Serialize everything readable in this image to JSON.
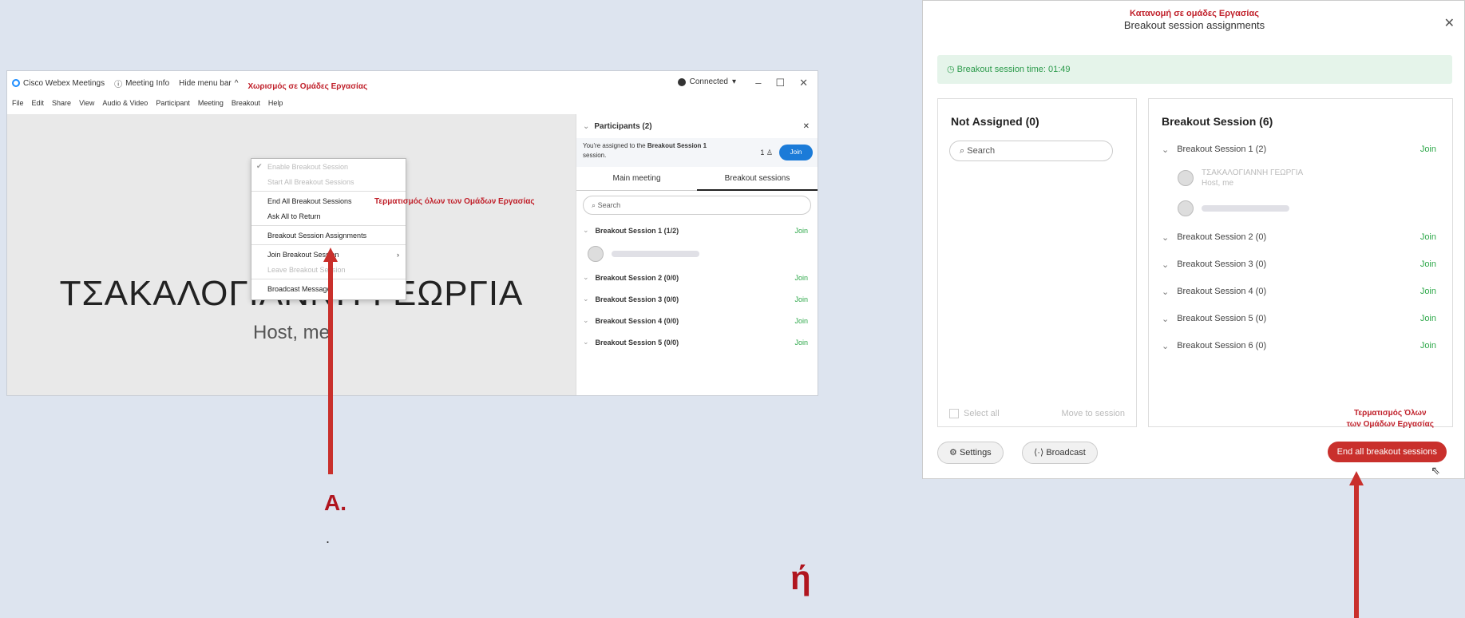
{
  "webex": {
    "app_name": "Cisco Webex Meetings",
    "meeting_info": "Meeting Info",
    "hide_menu": "Hide menu bar",
    "connected": "Connected",
    "menu": [
      "File",
      "Edit",
      "Share",
      "View",
      "Audio & Video",
      "Participant",
      "Meeting",
      "Breakout",
      "Help"
    ],
    "annotation_top": "Χωρισμός σε Ομάδες Εργασίας",
    "dropdown": [
      {
        "label": "Enable Breakout Session",
        "disabled": true
      },
      {
        "label": "Start All Breakout Sessions",
        "disabled": true
      },
      {
        "label": "End All Breakout Sessions",
        "disabled": false
      },
      {
        "label": "Ask All to Return",
        "disabled": false
      },
      {
        "label": "Breakout Session Assignments",
        "disabled": false
      },
      {
        "label": "Join Breakout Session",
        "disabled": false
      },
      {
        "label": "Leave Breakout Session",
        "disabled": true
      },
      {
        "label": "Broadcast Message",
        "disabled": false
      }
    ],
    "dropdown_annotation": "Τερματισμός όλων των Ομάδων Εργασίας",
    "stage_name": "ΤΣΑΚΑΛΟΓΙΑΝΝΗ ΓΕΩΡΓΙΑ",
    "stage_role": "Host, me",
    "participants": {
      "title": "Participants (2)",
      "assigned_msg_1": "You're assigned to the ",
      "assigned_msg_bold": "Breakout Session 1",
      "assigned_msg_2": " session.",
      "count": "1",
      "join": "Join",
      "tabs": [
        "Main meeting",
        "Breakout sessions"
      ],
      "search": "Search",
      "sessions": [
        "Breakout Session 1 (1/2)",
        "Breakout Session 2 (0/0)",
        "Breakout Session 3 (0/0)",
        "Breakout Session 4 (0/0)",
        "Breakout Session 5 (0/0)"
      ],
      "join_label": "Join"
    }
  },
  "labels": {
    "a": "A.",
    "dot": ".",
    "or": "ή"
  },
  "dialog": {
    "title_red": "Κατανομή σε ομάδες Εργασίας",
    "title": "Breakout session assignments",
    "timer": "Breakout session time: 01:49",
    "not_assigned_title": "Not Assigned (0)",
    "search": "Search",
    "select_all": "Select all",
    "move_to_session": "Move to session",
    "breakout_title": "Breakout Session  (6)",
    "sessions": [
      "Breakout Session 1 (2)",
      "Breakout Session 2 (0)",
      "Breakout Session 3 (0)",
      "Breakout Session 4 (0)",
      "Breakout Session 5 (0)",
      "Breakout Session 6 (0)"
    ],
    "member_name": "ΤΣΑΚΑΛΟΓΙΑΝΝΗ ΓΕΩΡΓΙΑ",
    "member_role": "Host, me",
    "join": "Join",
    "settings": "Settings",
    "broadcast": "Broadcast",
    "end_annotation_1": "Τερματισμός Όλων",
    "end_annotation_2": "των Ομάδων Εργασίας",
    "end_button": "End all breakout sessions"
  },
  "colors": {
    "accent_red": "#c9302c",
    "join_green": "#2ea84a",
    "webex_blue": "#1b7bd8"
  }
}
